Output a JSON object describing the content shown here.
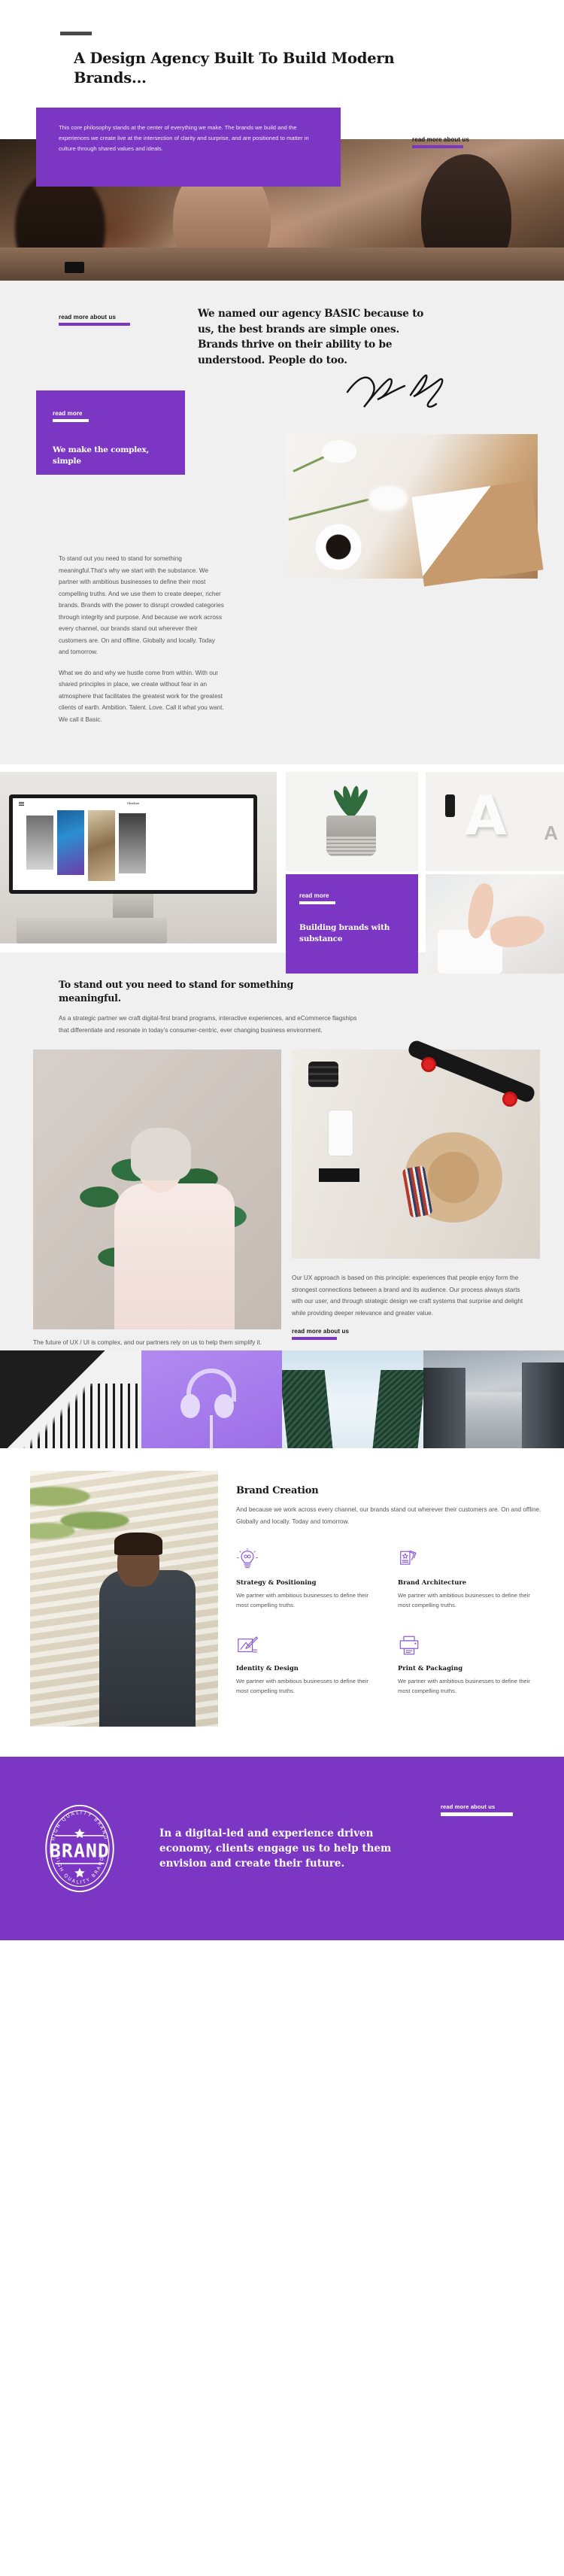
{
  "brand_color": "#7b37c4",
  "hero": {
    "title": "A Design Agency Built To Build Modern Brands...",
    "philosophy": "This core philosophy stands at the center of everything we make. The brands we build and the experiences we create live at the intersection of clarity and surprise, and are positioned to matter in culture through shared values and ideals.",
    "cta_label": "read more about us"
  },
  "basic": {
    "cta_label": "read more about us",
    "heading": "We named our agency BASIC because to us, the best brands are simple ones. Brands thrive on their ability to be understood. People do too.",
    "card": {
      "cta_label": "read more",
      "title": "We make the complex, simple"
    },
    "paragraph_1": "To stand out you need to stand for something meaningful.That’s why we start with the substance. We partner with ambitious businesses to define their most compelling truths. And we use them to create deeper, richer brands. Brands with the power to disrupt crowded categories through integrity and purpose. And because we work across every channel, our brands stand out wherever their customers are. On and offline. Globally and locally. Today and tomorrow.",
    "paragraph_2": "What we do and why we hustle come from within. With our shared principles in place, we create without fear in an atmosphere that facilitates the greatest work for the greatest clients of earth. Ambition. Talent. Love. Call it what you want. We call it Basic."
  },
  "mosaic": {
    "monitor_site_title": "Obsidian",
    "purple_tile": {
      "cta_label": "read more",
      "title": "Building brands with substance"
    }
  },
  "standout": {
    "heading": "To stand out you need to stand for something meaningful.",
    "sub": "As a strategic partner we craft digital-first brand programs, interactive experiences, and eCommerce flagships that differentiate and resonate in today’s consumer-centric, ever changing business environment.",
    "note_right": "Our UX approach is based on this principle: experiences that people enjoy form the strongest connections between a brand and its audience. Our process always starts with our user, and through strategic design we craft systems that surprise and delight while providing deeper relevance and greater value.",
    "note_right_cta": "read more about us",
    "note_left": "The future of UX / UI is complex, and our partners rely on us to help them simplify it. We design websites, applications, and digital products that build modern brands and form authentic relationships."
  },
  "brand_creation": {
    "title": "Brand Creation",
    "lead": "And because we work across every channel, our brands stand out wherever their customers are. On and offline. Globally and locally. Today and tomorrow.",
    "features": [
      {
        "icon": "lightbulb-icon",
        "title": "Strategy & Positioning",
        "text": "We partner with ambitious businesses to define their most compelling truths."
      },
      {
        "icon": "cards-star-icon",
        "title": "Brand Architecture",
        "text": "We partner with ambitious businesses to define their most compelling truths."
      },
      {
        "icon": "pencil-sketch-icon",
        "title": "Identity & Design",
        "text": "We partner with ambitious businesses to define their most compelling truths."
      },
      {
        "icon": "printer-icon",
        "title": "Print & Packaging",
        "text": "We partner with ambitious businesses to define their most compelling truths."
      }
    ]
  },
  "footer_cta": {
    "badge_word": "BRAND",
    "badge_ring_text": "HIGH QUALITY BRAND",
    "heading": "In a digital-led and experience driven economy, clients engage us to help them envision and create their future.",
    "cta_label": "read more about us"
  }
}
